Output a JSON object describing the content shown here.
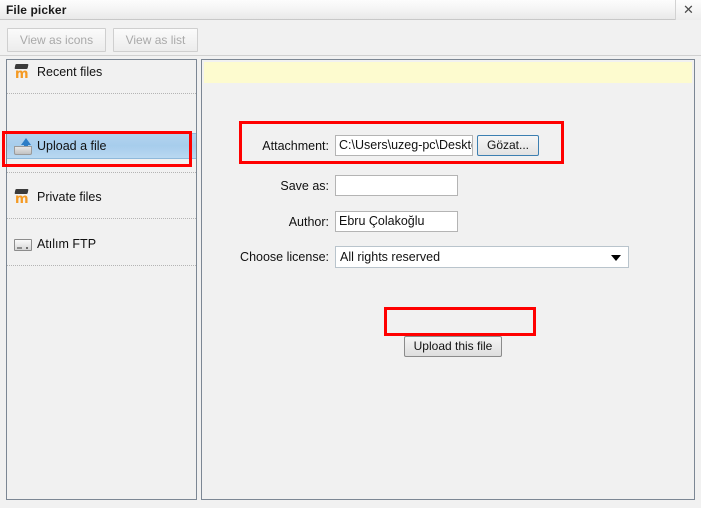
{
  "window": {
    "title": "File picker",
    "close_icon": "close-icon",
    "close_label": "✕"
  },
  "toolbar": {
    "view_as_icons": "View as icons",
    "view_as_list": "View as list"
  },
  "sidebar": {
    "items": [
      {
        "label": "Recent files",
        "icon": "moodle-logo-icon",
        "selected": false
      },
      {
        "label": "Upload a file",
        "icon": "upload-tray-icon",
        "selected": true
      },
      {
        "label": "Private files",
        "icon": "moodle-logo-icon",
        "selected": false
      },
      {
        "label": "Atılım FTP",
        "icon": "server-icon",
        "selected": false
      }
    ]
  },
  "main": {
    "banner_text": "",
    "form": {
      "attachment": {
        "label": "Attachment:",
        "value": "C:\\Users\\uzeg-pc\\Deskto",
        "placeholder": "",
        "browse_button": "Gözat..."
      },
      "save_as": {
        "label": "Save as:",
        "value": "",
        "placeholder": ""
      },
      "author": {
        "label": "Author:",
        "value": "Ebru Çolakoğlu",
        "placeholder": ""
      },
      "license": {
        "label": "Choose license:",
        "selected": "All rights reserved",
        "arrow_icon": "chevron-down-icon"
      }
    },
    "upload_button": "Upload this file"
  },
  "colors": {
    "accent_selected": "#a7cdec",
    "annotation_red": "#ff0000",
    "banner_yellow": "#fdfbcf",
    "focus_blue": "#3c7fb1"
  }
}
